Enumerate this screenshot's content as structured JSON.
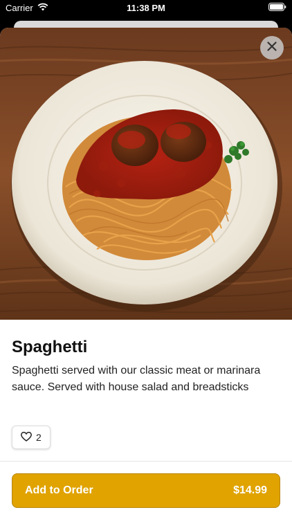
{
  "status_bar": {
    "carrier": "Carrier",
    "time": "11:38 PM"
  },
  "item": {
    "name": "Spaghetti",
    "description": "Spaghetti served with our classic meat or marinara sauce. Served with house salad and breadsticks",
    "likes": "2"
  },
  "order_button": {
    "label": "Add to Order",
    "price": "$14.99"
  },
  "icons": {
    "close": "close-icon",
    "heart": "heart-icon",
    "wifi": "wifi-icon",
    "battery": "battery-icon"
  },
  "colors": {
    "accent": "#e0a300"
  }
}
